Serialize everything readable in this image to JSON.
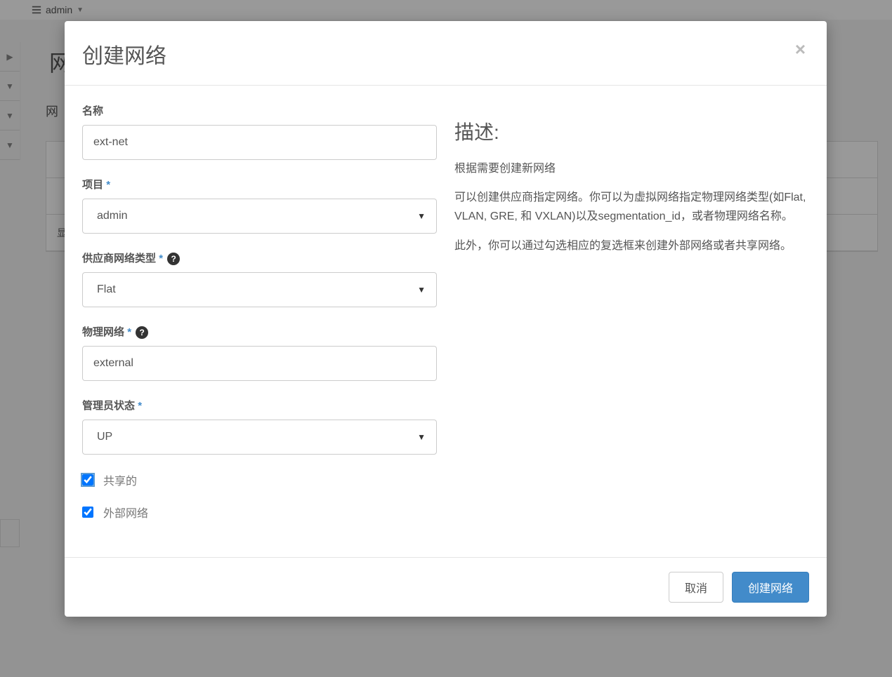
{
  "topbar": {
    "project": "admin"
  },
  "background": {
    "page_title": "网",
    "tab_label": "网",
    "table_hint": "显"
  },
  "modal": {
    "title": "创建网络",
    "close": "×"
  },
  "form": {
    "name_label": "名称",
    "name_value": "ext-net",
    "project_label": "项目",
    "project_value": "admin",
    "provider_type_label": "供应商网络类型",
    "provider_type_value": "Flat",
    "physical_network_label": "物理网络",
    "physical_network_value": "external",
    "admin_state_label": "管理员状态",
    "admin_state_value": "UP",
    "shared_label": "共享的",
    "external_label": "外部网络"
  },
  "description": {
    "title": "描述:",
    "text1": "根据需要创建新网络",
    "text2": "可以创建供应商指定网络。你可以为虚拟网络指定物理网络类型(如Flat, VLAN, GRE, 和 VXLAN)以及segmentation_id，或者物理网络名称。",
    "text3": "此外，你可以通过勾选相应的复选框来创建外部网络或者共享网络。"
  },
  "footer": {
    "cancel": "取消",
    "submit": "创建网络"
  }
}
